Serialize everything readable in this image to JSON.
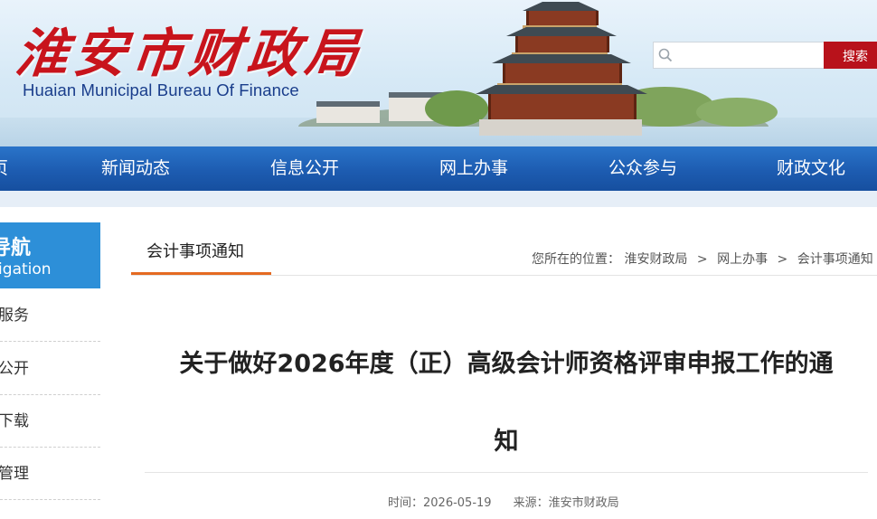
{
  "header": {
    "logo_cn": "淮安市财政局",
    "logo_en": "Huaian Municipal Bureau Of Finance"
  },
  "search": {
    "placeholder": "",
    "button_label": "搜索"
  },
  "nav": {
    "items": [
      "页",
      "新闻动态",
      "信息公开",
      "网上办事",
      "公众参与",
      "财政文化"
    ]
  },
  "sidebar": {
    "title_cn": "导航",
    "title_en": "vigation",
    "items": [
      "服务",
      "公开",
      "下载",
      "管理"
    ]
  },
  "tab": {
    "title": "会计事项通知"
  },
  "breadcrumb": {
    "label": "您所在的位置：",
    "items": [
      "淮安财政局",
      "网上办事",
      "会计事项通知"
    ],
    "separator": ">"
  },
  "article": {
    "title_line1": "关于做好2026年度（正）高级会计师资格评审申报工作的通",
    "title_line2": "知",
    "time_label": "时间：",
    "time_value": "2026-05-19",
    "source_label": "来源：",
    "source_value": "淮安市财政局"
  },
  "colors": {
    "brand_red": "#c8141c",
    "nav_blue": "#1d5cb1",
    "sidebar_blue": "#2d8fd8",
    "tab_accent": "#e46a21"
  }
}
